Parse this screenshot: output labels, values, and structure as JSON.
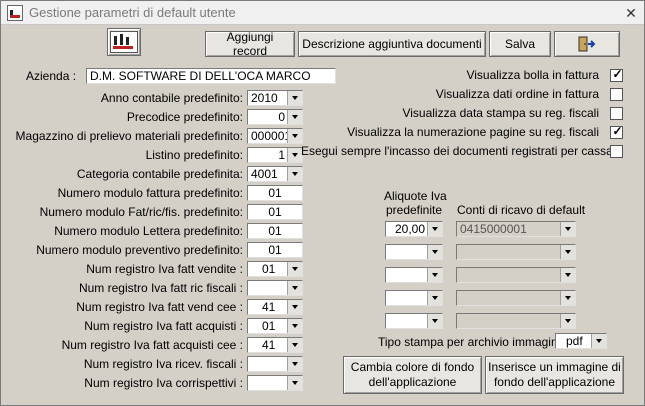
{
  "window": {
    "title": "Gestione parametri di default utente",
    "close_glyph": "✕"
  },
  "toolbar": {
    "logo_icon": "dm-logo-icon",
    "buttons": [
      {
        "label": "Aggiungi record"
      },
      {
        "label": "Descrizione aggiuntiva documenti"
      },
      {
        "label": "Salva"
      },
      {
        "icon": "exit-door-icon"
      }
    ]
  },
  "azienda": {
    "label": "Azienda :",
    "value": "D.M. SOFTWARE DI DELL'OCA MARCO"
  },
  "fields": [
    {
      "label": "Anno contabile predefinito:",
      "value": "2010",
      "kind": "combo"
    },
    {
      "label": "Precodice predefinito:",
      "value": "0",
      "kind": "combo"
    },
    {
      "label": "Magazzino di prelievo materiali predefinito:",
      "value": "000001",
      "kind": "combo"
    },
    {
      "label": "Listino predefinito:",
      "value": "1",
      "kind": "combo"
    },
    {
      "label": "Categoria contabile predefinita:",
      "value": "4001",
      "kind": "combo"
    },
    {
      "label": "Numero modulo fattura predefinito:",
      "value": "01",
      "kind": "text"
    },
    {
      "label": "Numero modulo Fat/ric/fis. predefinito:",
      "value": "01",
      "kind": "text"
    },
    {
      "label": "Numero modulo Lettera predefinito:",
      "value": "01",
      "kind": "text"
    },
    {
      "label": "Numero modulo preventivo predefinito:",
      "value": "01",
      "kind": "text"
    },
    {
      "label": "Num registro Iva fatt vendite :",
      "value": "01",
      "kind": "combo"
    },
    {
      "label": "Num registro Iva fatt ric fiscali :",
      "value": "",
      "kind": "combo"
    },
    {
      "label": "Num registro Iva fatt vend cee :",
      "value": "41",
      "kind": "combo"
    },
    {
      "label": "Num registro Iva fatt acquisti :",
      "value": "01",
      "kind": "combo"
    },
    {
      "label": "Num registro Iva fatt acquisti cee :",
      "value": "41",
      "kind": "combo"
    },
    {
      "label": "Num registro Iva ricev. fiscali :",
      "value": "",
      "kind": "combo"
    },
    {
      "label": "Num registro Iva corrispettivi :",
      "value": "",
      "kind": "combo"
    }
  ],
  "checkboxes": [
    {
      "label": "Visualizza bolla in fattura",
      "checked": true
    },
    {
      "label": "Visualizza dati ordine in fattura",
      "checked": false
    },
    {
      "label": "Visualizza data stampa su reg. fiscali",
      "checked": false
    },
    {
      "label": "Visualizza la numerazione pagine su reg. fiscali",
      "checked": true
    },
    {
      "label": "Esegui sempre l'incasso dei documenti registrati per cassa",
      "checked": false
    }
  ],
  "check_glyph": "✓",
  "aliquote": {
    "header_line1": "Aliquote Iva",
    "header_line2": "predefinite",
    "conti_header": "Conti di ricavo di default",
    "rows": [
      {
        "aliquota": "20,00",
        "conto": "0415000001"
      },
      {
        "aliquota": "",
        "conto": ""
      },
      {
        "aliquota": "",
        "conto": ""
      },
      {
        "aliquota": "",
        "conto": ""
      },
      {
        "aliquota": "",
        "conto": ""
      }
    ]
  },
  "tipo_stampa": {
    "label": "Tipo stampa per archivio immagini :",
    "value": "pdf"
  },
  "bottom_buttons": [
    {
      "line1": "Cambia colore di fondo",
      "line2": "dell'applicazione"
    },
    {
      "line1": "Inserisce un immagine di",
      "line2": "fondo dell'applicazione"
    }
  ]
}
